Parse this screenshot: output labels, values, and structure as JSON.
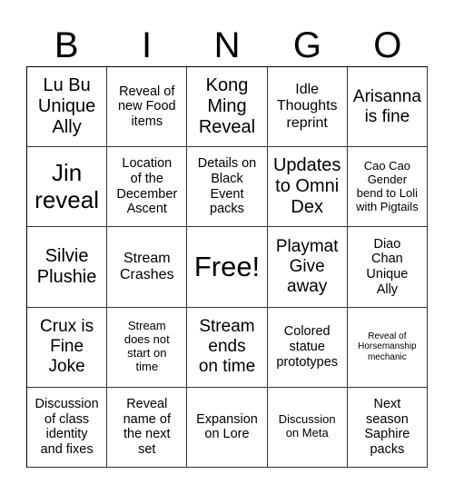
{
  "header": {
    "letters": [
      "B",
      "I",
      "N",
      "G",
      "O"
    ]
  },
  "cells": [
    "Lu Bu\nUnique\nAlly",
    "Reveal of\nnew Food\nitems",
    "Kong\nMing\nReveal",
    "Idle\nThoughts\nreprint",
    "Arisanna\nis fine",
    "Jin\nreveal",
    "Location\nof the\nDecember\nAscent",
    "Details on\nBlack\nEvent\npacks",
    "Updates\nto Omni\nDex",
    "Cao Cao\nGender\nbend to Loli\nwith Pigtails",
    "Silvie\nPlushie",
    "Stream\nCrashes",
    "Free!",
    "Playmat\nGive\naway",
    "Diao\nChan\nUnique\nAlly",
    "Crux is\nFine\nJoke",
    "Stream\ndoes not\nstart on\ntime",
    "Stream\nends\non time",
    "Colored\nstatue\nprototypes",
    "Reveal of\nHorsemanship\nmechanic",
    "Discussion\nof class\nidentity\nand fixes",
    "Reveal\nname of\nthe next\nset",
    "Expansion\non Lore",
    "Discussion\non Meta",
    "Next\nseason\nSaphire\npacks"
  ]
}
